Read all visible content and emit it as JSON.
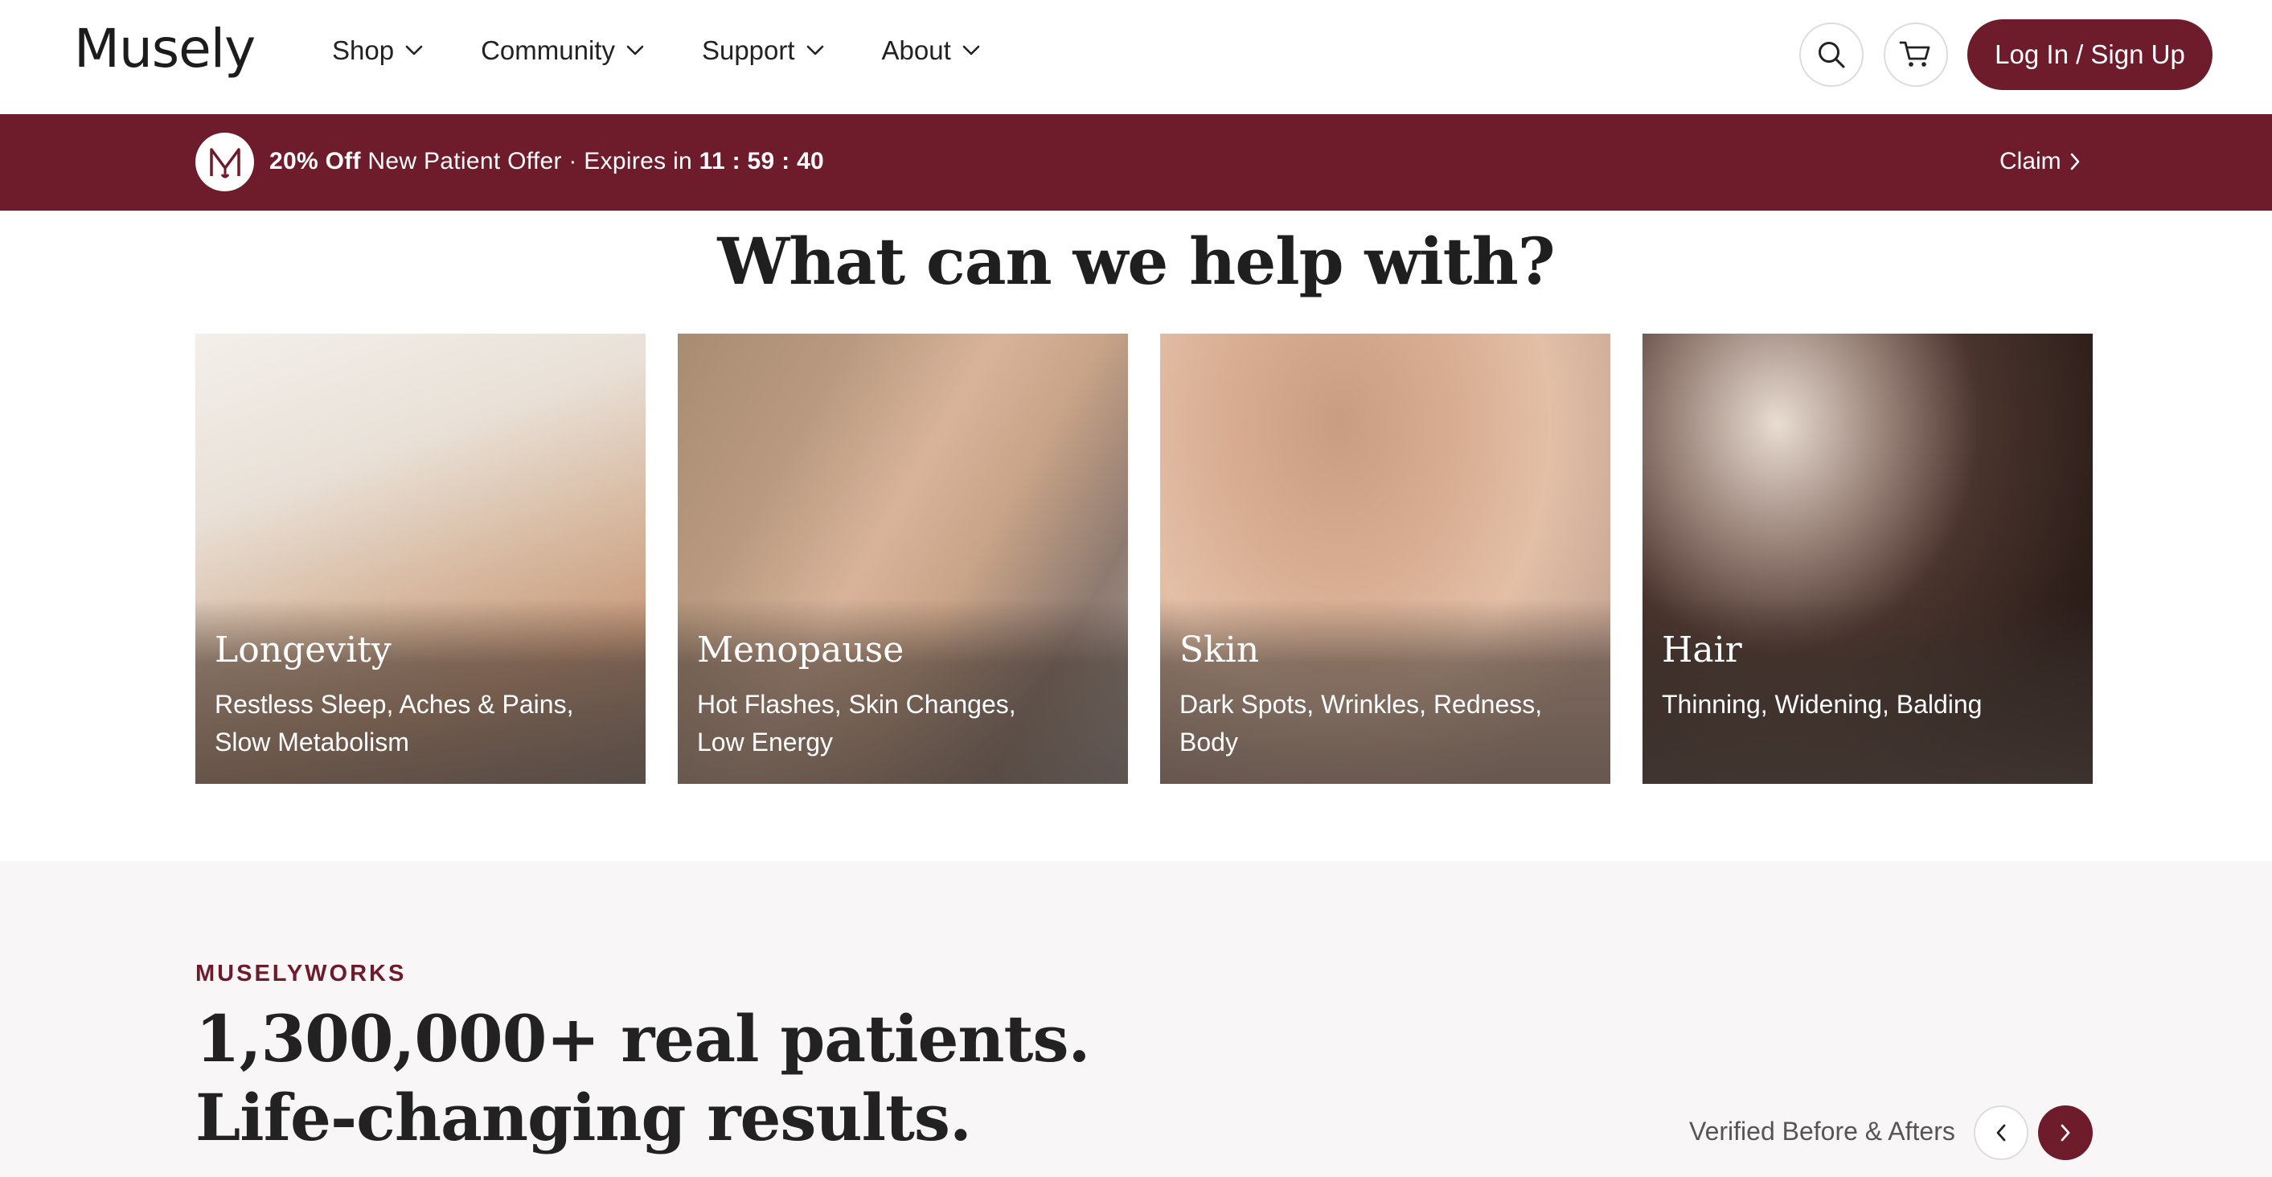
{
  "header": {
    "logo": "Musely",
    "nav": [
      {
        "label": "Shop"
      },
      {
        "label": "Community"
      },
      {
        "label": "Support"
      },
      {
        "label": "About"
      }
    ],
    "login_label": "Log In / Sign Up"
  },
  "promo": {
    "discount": "20% Off",
    "offer": " New Patient Offer · Expires in ",
    "timer": "11 : 59 : 40",
    "claim": "Claim"
  },
  "help": {
    "title": "What can we help with?",
    "cards": [
      {
        "title": "Longevity",
        "subtitle": "Restless Sleep, Aches & Pains, Slow Metabolism"
      },
      {
        "title": "Menopause",
        "subtitle": "Hot Flashes, Skin Changes, Low Energy"
      },
      {
        "title": "Skin",
        "subtitle": "Dark Spots, Wrinkles, Redness, Body"
      },
      {
        "title": "Hair",
        "subtitle": "Thinning, Widening, Balding"
      }
    ]
  },
  "results": {
    "eyebrow": "MUSELYWORKS",
    "headline_1": "1,300,000+ real patients.",
    "headline_2": "Life-changing results.",
    "verified_label": "Verified Before & Afters"
  },
  "colors": {
    "brand": "#6e1b2b",
    "section_bg": "#f8f6f6"
  }
}
